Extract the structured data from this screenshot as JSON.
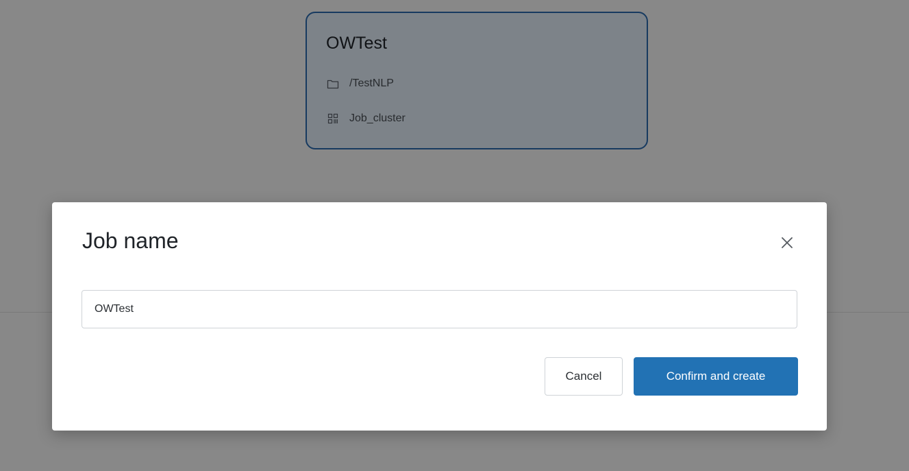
{
  "background": {
    "task_card": {
      "title": "OWTest",
      "path_icon": "folder-icon",
      "path": "/TestNLP",
      "cluster_icon": "cluster-icon",
      "cluster": "Job_cluster"
    }
  },
  "modal": {
    "title": "Job name",
    "close_icon": "close-icon",
    "job_name_value": "OWTest",
    "cancel_label": "Cancel",
    "confirm_label": "Confirm and create"
  },
  "colors": {
    "primary": "#2272b4",
    "overlay": "rgba(0,0,0,0.45)"
  }
}
